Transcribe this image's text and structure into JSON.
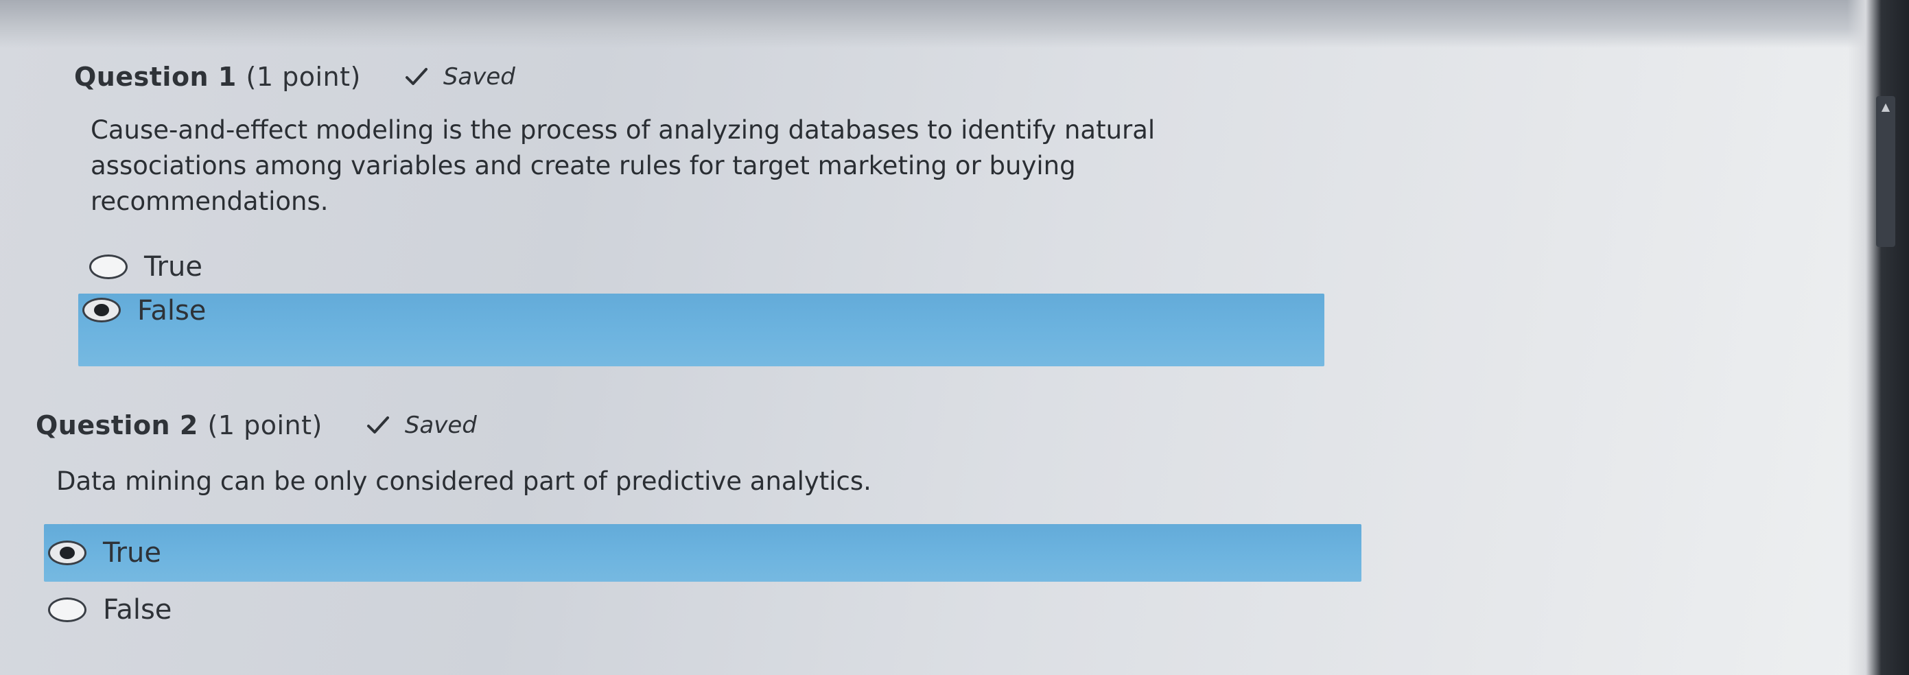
{
  "questions": [
    {
      "title": "Question 1",
      "points": "(1 point)",
      "status": "Saved",
      "status_icon": "check-icon",
      "text": "Cause-and-effect modeling is the process of analyzing databases to identify natural associations among variables and create rules for target marketing or buying recommendations.",
      "options": [
        {
          "label": "True",
          "selected": false
        },
        {
          "label": "False",
          "selected": true
        }
      ]
    },
    {
      "title": "Question 2",
      "points": "(1 point)",
      "status": "Saved",
      "status_icon": "check-icon",
      "text": "Data mining can be only considered part of predictive analytics.",
      "options": [
        {
          "label": "True",
          "selected": true
        },
        {
          "label": "False",
          "selected": false
        }
      ]
    }
  ],
  "colors": {
    "selected_highlight": "#6cb3df",
    "text": "#2b2f36"
  }
}
